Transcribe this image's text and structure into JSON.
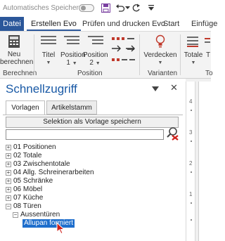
{
  "qat": {
    "autosave_label": "Automatisches Speichern",
    "autosave_state": "off"
  },
  "tabs": [
    "Datei",
    "Erstellen Evo",
    "Prüfen und drucken Evo",
    "Start",
    "Einfüge"
  ],
  "active_tab": "Erstellen Evo",
  "ribbon": {
    "new_line1": "Neu",
    "new_line2": "berechnen",
    "group_berechnen": "Berechnen",
    "titel": "Titel",
    "position1": "Position",
    "position1_sub": "1",
    "position2": "Position",
    "position2_sub": "2",
    "group_position": "Position",
    "verdecken": "Verdecken",
    "group_varianten": "Varianten",
    "totale": "Totale",
    "group_cut": "To",
    "col_t": "T"
  },
  "pane": {
    "title": "Schnellzugriff",
    "tabs": [
      "Vorlagen",
      "Artikelstamm"
    ],
    "active_tab": "Vorlagen",
    "save_button": "Selektion als Vorlage speichern",
    "search_value": "",
    "tree": [
      {
        "label": "01 Positionen",
        "expander": "+",
        "level": 0
      },
      {
        "label": "02 Totale",
        "expander": "+",
        "level": 0
      },
      {
        "label": "03 Zwischentotale",
        "expander": "+",
        "level": 0
      },
      {
        "label": "04 Allg. Schreinerarbeiten",
        "expander": "+",
        "level": 0
      },
      {
        "label": "05 Schränke",
        "expander": "+",
        "level": 0
      },
      {
        "label": "06 Möbel",
        "expander": "+",
        "level": 0
      },
      {
        "label": "07 Küche",
        "expander": "+",
        "level": 0
      },
      {
        "label": "08 Türen",
        "expander": "−",
        "level": 0
      },
      {
        "label": "Aussentüren",
        "expander": "−",
        "level": 1
      },
      {
        "label": "Allupan formiert",
        "expander": "",
        "level": 2,
        "selected": true
      }
    ]
  },
  "ruler": {
    "numbers": [
      "4",
      "3",
      "2",
      "1"
    ]
  },
  "colors": {
    "accent": "#2b579a",
    "title_blue": "#1a5aa6",
    "selection": "#1e6ecc",
    "save_icon": "#7a3fa0"
  }
}
